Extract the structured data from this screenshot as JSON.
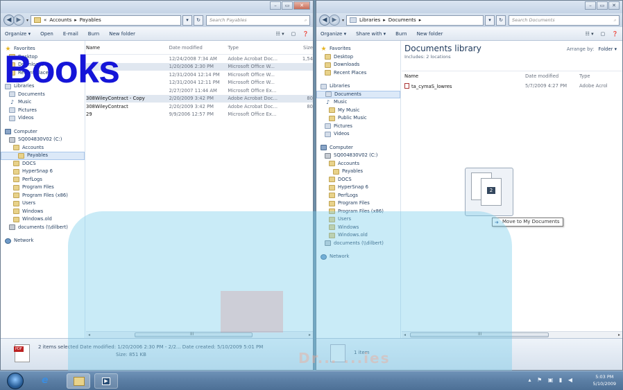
{
  "left": {
    "nav": {
      "back": "◀",
      "forward": "▶",
      "dropdown": "▾"
    },
    "address": {
      "overflow": "«",
      "crumbs": [
        "Accounts",
        "▸",
        "Payables"
      ],
      "dropdown": "▾",
      "refresh": "↻"
    },
    "search": {
      "placeholder": "Search Payables"
    },
    "toolbar": [
      "Organize ▾",
      "Open",
      "E-mail",
      "Burn",
      "New folder"
    ],
    "columns": [
      "Name",
      "Date modified",
      "Type",
      "Size"
    ],
    "files": [
      {
        "name": "",
        "date": "12/24/2008 7:34 AM",
        "type": "Adobe Acrobat Doc...",
        "size": "1,54",
        "sel": false
      },
      {
        "name": "",
        "date": "1/20/2006 2:30 PM",
        "type": "Microsoft Office W...",
        "size": "",
        "sel": true
      },
      {
        "name": "",
        "date": "12/31/2004 12:14 PM",
        "type": "Microsoft Office W...",
        "size": "",
        "sel": false
      },
      {
        "name": "",
        "date": "12/31/2004 12:11 PM",
        "type": "Microsoft Office W...",
        "size": "",
        "sel": false
      },
      {
        "name": "",
        "date": "2/27/2007 11:44 AM",
        "type": "Microsoft Office Ex...",
        "size": "",
        "sel": false
      },
      {
        "name": "308WileyContract - Copy",
        "date": "2/20/2009 3:42 PM",
        "type": "Adobe Acrobat Doc...",
        "size": "80",
        "sel": true
      },
      {
        "name": "308WileyContract",
        "date": "2/20/2009 3:42 PM",
        "type": "Adobe Acrobat Doc...",
        "size": "80",
        "sel": false
      },
      {
        "name": "29",
        "date": "9/9/2006 12:57 PM",
        "type": "Microsoft Office Ex...",
        "size": "",
        "sel": false
      }
    ],
    "navpane": [
      {
        "label": "Favorites",
        "icon": "star"
      },
      {
        "label": "Desktop",
        "icon": "fold"
      },
      {
        "label": "Downloads",
        "icon": "fold"
      },
      {
        "label": "Recent Places",
        "icon": "fold"
      },
      {
        "gap": true
      },
      {
        "label": "Libraries",
        "icon": "lib"
      },
      {
        "label": "Documents",
        "icon": "lib"
      },
      {
        "label": "Music",
        "icon": "music"
      },
      {
        "label": "Pictures",
        "icon": "lib"
      },
      {
        "label": "Videos",
        "icon": "lib"
      },
      {
        "gap": true
      },
      {
        "label": "Computer",
        "icon": "comp"
      },
      {
        "label": "SQ004830V02 (C:)",
        "icon": "drive"
      },
      {
        "label": "Accounts",
        "icon": "fold"
      },
      {
        "label": "Payables",
        "icon": "fold",
        "sel": true
      },
      {
        "label": "DOCS",
        "icon": "fold"
      },
      {
        "label": "HyperSnap 6",
        "icon": "fold"
      },
      {
        "label": "PerfLogs",
        "icon": "fold"
      },
      {
        "label": "Program Files",
        "icon": "fold"
      },
      {
        "label": "Program Files (x86)",
        "icon": "fold"
      },
      {
        "label": "Users",
        "icon": "fold"
      },
      {
        "label": "Windows",
        "icon": "fold"
      },
      {
        "label": "Windows.old",
        "icon": "fold"
      },
      {
        "label": "documents (\\\\dilbert)",
        "icon": "drive"
      },
      {
        "gap": true
      },
      {
        "label": "Network",
        "icon": "net"
      }
    ],
    "details": {
      "line1": "2 items selected   Date modified: 1/20/2006 2:30 PM - 2/2...   Date created: 5/10/2009 5:01 PM",
      "line2": "Size: 851 KB",
      "pdf": "PDF"
    }
  },
  "right": {
    "nav": {
      "back": "◀",
      "forward": "▶",
      "dropdown": "▾"
    },
    "address": {
      "overflow": "",
      "crumbs": [
        "Libraries",
        "▸",
        "Documents",
        "▸"
      ],
      "dropdown": "▾",
      "refresh": "↻"
    },
    "search": {
      "placeholder": "Search Documents"
    },
    "toolbar": [
      "Organize ▾",
      "Share with ▾",
      "Burn",
      "New folder"
    ],
    "library": {
      "title": "Documents library",
      "includes": "Includes: 2 locations",
      "arrange_label": "Arrange by:",
      "arrange_value": "Folder ▾"
    },
    "columns": [
      "Name",
      "Date modified",
      "Type"
    ],
    "files": [
      {
        "name": "ta_cymaS_lowres",
        "date": "5/7/2009 4:27 PM",
        "type": "Adobe Acrob"
      }
    ],
    "navpane": [
      {
        "label": "Favorites",
        "icon": "star"
      },
      {
        "label": "Desktop",
        "icon": "fold"
      },
      {
        "label": "Downloads",
        "icon": "fold"
      },
      {
        "label": "Recent Places",
        "icon": "fold"
      },
      {
        "gap": true
      },
      {
        "label": "Libraries",
        "icon": "lib"
      },
      {
        "label": "Documents",
        "icon": "lib",
        "sel": true
      },
      {
        "label": "Music",
        "icon": "music"
      },
      {
        "label": "My Music",
        "icon": "fold"
      },
      {
        "label": "Public Music",
        "icon": "fold"
      },
      {
        "label": "Pictures",
        "icon": "lib"
      },
      {
        "label": "Videos",
        "icon": "lib"
      },
      {
        "gap": true
      },
      {
        "label": "Computer",
        "icon": "comp"
      },
      {
        "label": "SQ004830V02 (C:)",
        "icon": "drive"
      },
      {
        "label": "Accounts",
        "icon": "fold"
      },
      {
        "label": "Payables",
        "icon": "fold"
      },
      {
        "label": "DOCS",
        "icon": "fold"
      },
      {
        "label": "HyperSnap 6",
        "icon": "fold"
      },
      {
        "label": "PerfLogs",
        "icon": "fold"
      },
      {
        "label": "Program Files",
        "icon": "fold"
      },
      {
        "label": "Program Files (x86)",
        "icon": "fold"
      },
      {
        "label": "Users",
        "icon": "fold"
      },
      {
        "label": "Windows",
        "icon": "fold"
      },
      {
        "label": "Windows.old",
        "icon": "fold"
      },
      {
        "label": "documents (\\\\dilbert)",
        "icon": "drive"
      },
      {
        "gap": true
      },
      {
        "label": "Network",
        "icon": "net"
      }
    ],
    "details": {
      "line1": "1 item"
    }
  },
  "drag": {
    "count": "2",
    "tooltip": "Move to My Documents"
  },
  "watermark": {
    "text": "Books"
  },
  "taskbar": {
    "time": "5:03 PM",
    "date": "5/10/2009"
  },
  "scroll": {
    "label": "III",
    "left": "◂",
    "right": "▸"
  },
  "caption": {
    "min": "–",
    "max": "▭",
    "close": "✕"
  },
  "colors": {
    "watermark": "#1515d8",
    "accent": "#1e395b"
  }
}
